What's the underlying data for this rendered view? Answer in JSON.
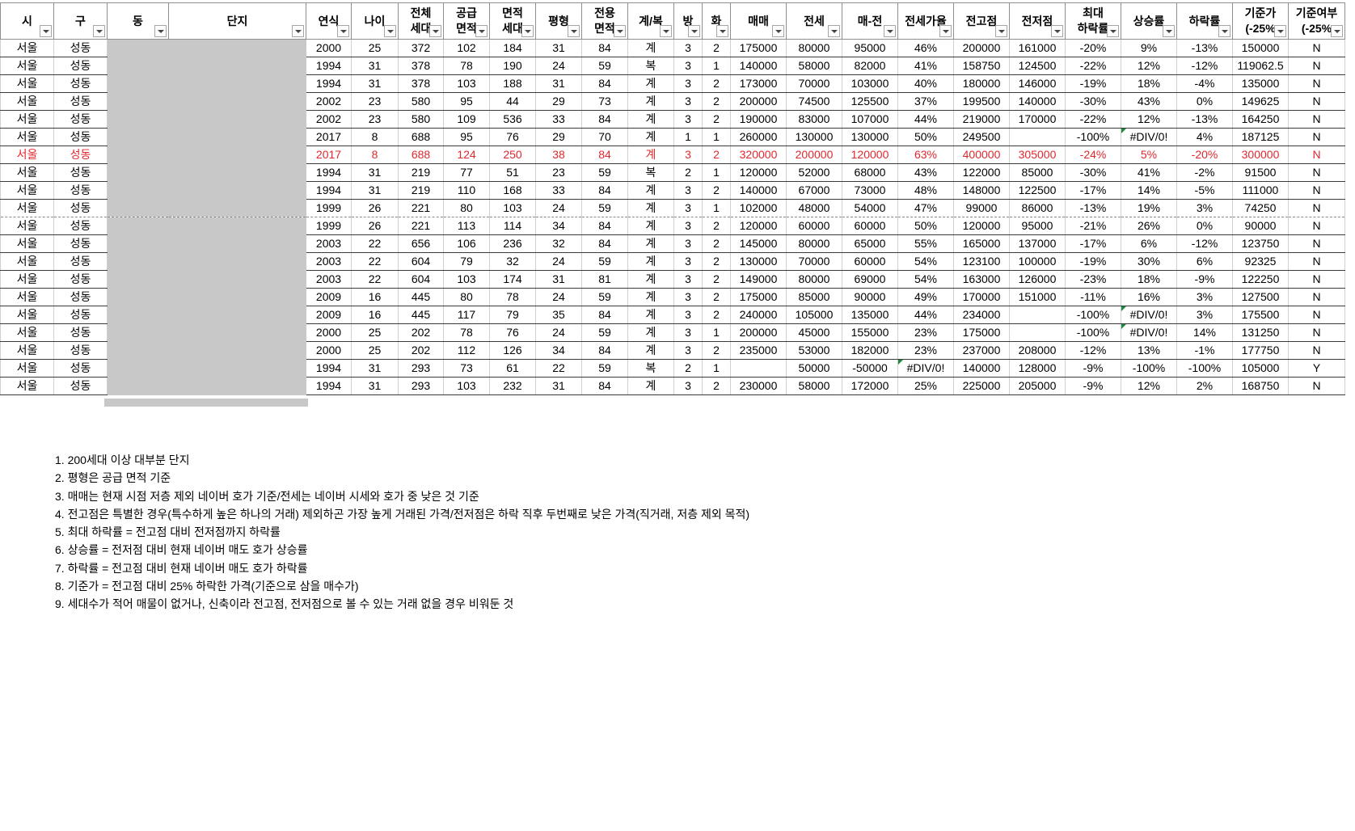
{
  "headers": [
    {
      "name": "col-si",
      "lines": [
        "시"
      ]
    },
    {
      "name": "col-gu",
      "lines": [
        "구"
      ]
    },
    {
      "name": "col-dong",
      "lines": [
        "동"
      ]
    },
    {
      "name": "col-danji",
      "lines": [
        "단지"
      ]
    },
    {
      "name": "col-yeonsik",
      "lines": [
        "연식"
      ]
    },
    {
      "name": "col-nai",
      "lines": [
        "나이"
      ]
    },
    {
      "name": "col-total-households",
      "lines": [
        "전체",
        "세대"
      ]
    },
    {
      "name": "col-supply-area",
      "lines": [
        "공급",
        "면적"
      ]
    },
    {
      "name": "col-area-households",
      "lines": [
        "면적",
        "세대"
      ]
    },
    {
      "name": "col-pyeong",
      "lines": [
        "평형"
      ]
    },
    {
      "name": "col-exclusive-area",
      "lines": [
        "전용",
        "면적"
      ]
    },
    {
      "name": "col-gye-bok",
      "lines": [
        "계/복"
      ]
    },
    {
      "name": "col-bang",
      "lines": [
        "방"
      ]
    },
    {
      "name": "col-hwa",
      "lines": [
        "화"
      ]
    },
    {
      "name": "col-maemae",
      "lines": [
        "매매"
      ]
    },
    {
      "name": "col-jeonse",
      "lines": [
        "전세"
      ]
    },
    {
      "name": "col-gap",
      "lines": [
        "매-전"
      ]
    },
    {
      "name": "col-jeonse-ratio",
      "lines": [
        "전세가율"
      ]
    },
    {
      "name": "col-prev-high",
      "lines": [
        "전고점"
      ]
    },
    {
      "name": "col-prev-low",
      "lines": [
        "전저점"
      ]
    },
    {
      "name": "col-max-drop",
      "lines": [
        "최대",
        "하락률"
      ]
    },
    {
      "name": "col-rise-rate",
      "lines": [
        "상승률"
      ]
    },
    {
      "name": "col-drop-rate",
      "lines": [
        "하락률"
      ]
    },
    {
      "name": "col-base-price",
      "lines": [
        "기준가",
        "(-25%"
      ]
    },
    {
      "name": "col-base-flag",
      "lines": [
        "기준여부",
        "(-25%"
      ]
    }
  ],
  "rows": [
    [
      "서울",
      "성동",
      "",
      "",
      "2000",
      "25",
      "372",
      "102",
      "184",
      "31",
      "84",
      "계",
      "3",
      "2",
      "175000",
      "80000",
      "95000",
      "46%",
      "200000",
      "161000",
      "-20%",
      "9%",
      "-13%",
      "150000",
      "N"
    ],
    [
      "서울",
      "성동",
      "",
      "",
      "1994",
      "31",
      "378",
      "78",
      "190",
      "24",
      "59",
      "복",
      "3",
      "1",
      "140000",
      "58000",
      "82000",
      "41%",
      "158750",
      "124500",
      "-22%",
      "12%",
      "-12%",
      "119062.5",
      "N"
    ],
    [
      "서울",
      "성동",
      "",
      "",
      "1994",
      "31",
      "378",
      "103",
      "188",
      "31",
      "84",
      "계",
      "3",
      "2",
      "173000",
      "70000",
      "103000",
      "40%",
      "180000",
      "146000",
      "-19%",
      "18%",
      "-4%",
      "135000",
      "N"
    ],
    [
      "서울",
      "성동",
      "",
      "",
      "2002",
      "23",
      "580",
      "95",
      "44",
      "29",
      "73",
      "계",
      "3",
      "2",
      "200000",
      "74500",
      "125500",
      "37%",
      "199500",
      "140000",
      "-30%",
      "43%",
      "0%",
      "149625",
      "N"
    ],
    [
      "서울",
      "성동",
      "",
      "",
      "2002",
      "23",
      "580",
      "109",
      "536",
      "33",
      "84",
      "계",
      "3",
      "2",
      "190000",
      "83000",
      "107000",
      "44%",
      "219000",
      "170000",
      "-22%",
      "12%",
      "-13%",
      "164250",
      "N"
    ],
    [
      "서울",
      "성동",
      "",
      "",
      "2017",
      "8",
      "688",
      "95",
      "76",
      "29",
      "70",
      "계",
      "1",
      "1",
      "260000",
      "130000",
      "130000",
      "50%",
      "249500",
      "",
      "-100%",
      "#DIV/0!",
      "4%",
      "187125",
      "N"
    ],
    [
      "서울",
      "성동",
      "",
      "",
      "2017",
      "8",
      "688",
      "124",
      "250",
      "38",
      "84",
      "계",
      "3",
      "2",
      "320000",
      "200000",
      "120000",
      "63%",
      "400000",
      "305000",
      "-24%",
      "5%",
      "-20%",
      "300000",
      "N"
    ],
    [
      "서울",
      "성동",
      "",
      "",
      "1994",
      "31",
      "219",
      "77",
      "51",
      "23",
      "59",
      "복",
      "2",
      "1",
      "120000",
      "52000",
      "68000",
      "43%",
      "122000",
      "85000",
      "-30%",
      "41%",
      "-2%",
      "91500",
      "N"
    ],
    [
      "서울",
      "성동",
      "",
      "",
      "1994",
      "31",
      "219",
      "110",
      "168",
      "33",
      "84",
      "계",
      "3",
      "2",
      "140000",
      "67000",
      "73000",
      "48%",
      "148000",
      "122500",
      "-17%",
      "14%",
      "-5%",
      "111000",
      "N"
    ],
    [
      "서울",
      "성동",
      "",
      "",
      "1999",
      "26",
      "221",
      "80",
      "103",
      "24",
      "59",
      "계",
      "3",
      "1",
      "102000",
      "48000",
      "54000",
      "47%",
      "99000",
      "86000",
      "-13%",
      "19%",
      "3%",
      "74250",
      "N"
    ],
    [
      "서울",
      "성동",
      "",
      "",
      "1999",
      "26",
      "221",
      "113",
      "114",
      "34",
      "84",
      "계",
      "3",
      "2",
      "120000",
      "60000",
      "60000",
      "50%",
      "120000",
      "95000",
      "-21%",
      "26%",
      "0%",
      "90000",
      "N"
    ],
    [
      "서울",
      "성동",
      "",
      "",
      "2003",
      "22",
      "656",
      "106",
      "236",
      "32",
      "84",
      "계",
      "3",
      "2",
      "145000",
      "80000",
      "65000",
      "55%",
      "165000",
      "137000",
      "-17%",
      "6%",
      "-12%",
      "123750",
      "N"
    ],
    [
      "서울",
      "성동",
      "",
      "",
      "2003",
      "22",
      "604",
      "79",
      "32",
      "24",
      "59",
      "계",
      "3",
      "2",
      "130000",
      "70000",
      "60000",
      "54%",
      "123100",
      "100000",
      "-19%",
      "30%",
      "6%",
      "92325",
      "N"
    ],
    [
      "서울",
      "성동",
      "",
      "",
      "2003",
      "22",
      "604",
      "103",
      "174",
      "31",
      "81",
      "계",
      "3",
      "2",
      "149000",
      "80000",
      "69000",
      "54%",
      "163000",
      "126000",
      "-23%",
      "18%",
      "-9%",
      "122250",
      "N"
    ],
    [
      "서울",
      "성동",
      "",
      "",
      "2009",
      "16",
      "445",
      "80",
      "78",
      "24",
      "59",
      "계",
      "3",
      "2",
      "175000",
      "85000",
      "90000",
      "49%",
      "170000",
      "151000",
      "-11%",
      "16%",
      "3%",
      "127500",
      "N"
    ],
    [
      "서울",
      "성동",
      "",
      "",
      "2009",
      "16",
      "445",
      "117",
      "79",
      "35",
      "84",
      "계",
      "3",
      "2",
      "240000",
      "105000",
      "135000",
      "44%",
      "234000",
      "",
      "-100%",
      "#DIV/0!",
      "3%",
      "175500",
      "N"
    ],
    [
      "서울",
      "성동",
      "",
      "",
      "2000",
      "25",
      "202",
      "78",
      "76",
      "24",
      "59",
      "계",
      "3",
      "1",
      "200000",
      "45000",
      "155000",
      "23%",
      "175000",
      "",
      "-100%",
      "#DIV/0!",
      "14%",
      "131250",
      "N"
    ],
    [
      "서울",
      "성동",
      "",
      "",
      "2000",
      "25",
      "202",
      "112",
      "126",
      "34",
      "84",
      "계",
      "3",
      "2",
      "235000",
      "53000",
      "182000",
      "23%",
      "237000",
      "208000",
      "-12%",
      "13%",
      "-1%",
      "177750",
      "N"
    ],
    [
      "서울",
      "성동",
      "",
      "",
      "1994",
      "31",
      "293",
      "73",
      "61",
      "22",
      "59",
      "복",
      "2",
      "1",
      "",
      "50000",
      "-50000",
      "#DIV/0!",
      "140000",
      "128000",
      "-9%",
      "-100%",
      "-100%",
      "105000",
      "Y"
    ],
    [
      "서울",
      "성동",
      "",
      "",
      "1994",
      "31",
      "293",
      "103",
      "232",
      "31",
      "84",
      "계",
      "3",
      "2",
      "230000",
      "58000",
      "172000",
      "25%",
      "225000",
      "205000",
      "-9%",
      "12%",
      "2%",
      "168750",
      "N"
    ]
  ],
  "notes": [
    "1. 200세대 이상 대부분 단지",
    "2. 평형은 공급 면적 기준",
    "3. 매매는 현재 시점 저층 제외 네이버 호가 기준/전세는 네이버 시세와 호가 중 낮은 것 기준",
    "4. 전고점은 특별한 경우(특수하게 높은 하나의 거래) 제외하곤 가장 높게 거래된 가격/전저점은 하락 직후 두번째로 낮은 가격(직거래, 저층 제외 목적)",
    "5. 최대 하락률 = 전고점 대비 전저점까지 하락률",
    "6. 상승률 = 전저점 대비 현재 네이버 매도 호가 상승률",
    "7. 하락률 = 전고점 대비 현재 네이버 매도 호가 하락률",
    "8. 기준가 = 전고점 대비 25% 하락한 가격(기준으로 삼을 매수가)",
    "9. 세대수가 적어 매물이 없거나, 신축이라 전고점, 전저점으로 볼 수 있는 거래 없을 경우 비워둔 것"
  ]
}
